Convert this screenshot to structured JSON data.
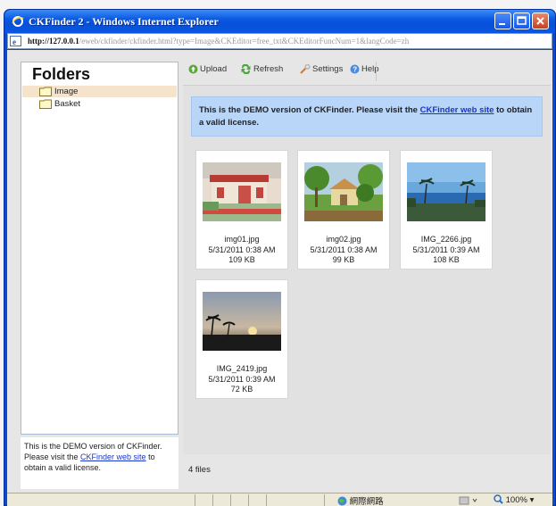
{
  "window": {
    "title": "CKFinder 2 - Windows Internet Explorer",
    "address_host": "http://127.0.0.1",
    "address_rest": "/eweb/ckfinder/ckfinder.html?type=Image&CKEditor=free_txt&CKEditorFuncNum=1&langCode=zh"
  },
  "folders": {
    "title": "Folders",
    "items": [
      {
        "label": "Image",
        "selected": true
      },
      {
        "label": "Basket",
        "selected": false
      }
    ]
  },
  "left_notice": {
    "before": "This is the DEMO version of CKFinder. Please visit the ",
    "link": "CKFinder web site",
    "after": " to obtain a valid license."
  },
  "toolbar": {
    "upload": "Upload",
    "refresh": "Refresh",
    "settings": "Settings",
    "help": "Help"
  },
  "banner": {
    "before": "This is the DEMO version of CKFinder. Please visit the ",
    "link": "CKFinder web site",
    "after": " to obtain a valid license."
  },
  "files": [
    {
      "name": "img01.jpg",
      "date": "5/31/2011 0:38 AM",
      "size": "109 KB"
    },
    {
      "name": "img02.jpg",
      "date": "5/31/2011 0:38 AM",
      "size": "99 KB"
    },
    {
      "name": "IMG_2266.jpg",
      "date": "5/31/2011 0:39 AM",
      "size": "108 KB"
    },
    {
      "name": "IMG_2419.jpg",
      "date": "5/31/2011 0:39 AM",
      "size": "72 KB"
    }
  ],
  "status": {
    "count": "4 files"
  },
  "ie_status": {
    "zone": "網際網路",
    "zoom": "100%"
  },
  "colors": {
    "titlebar": "#0a56e2",
    "banner": "#b9d5f7",
    "link": "#1a36c8",
    "selected_folder": "#f5e4cb"
  }
}
